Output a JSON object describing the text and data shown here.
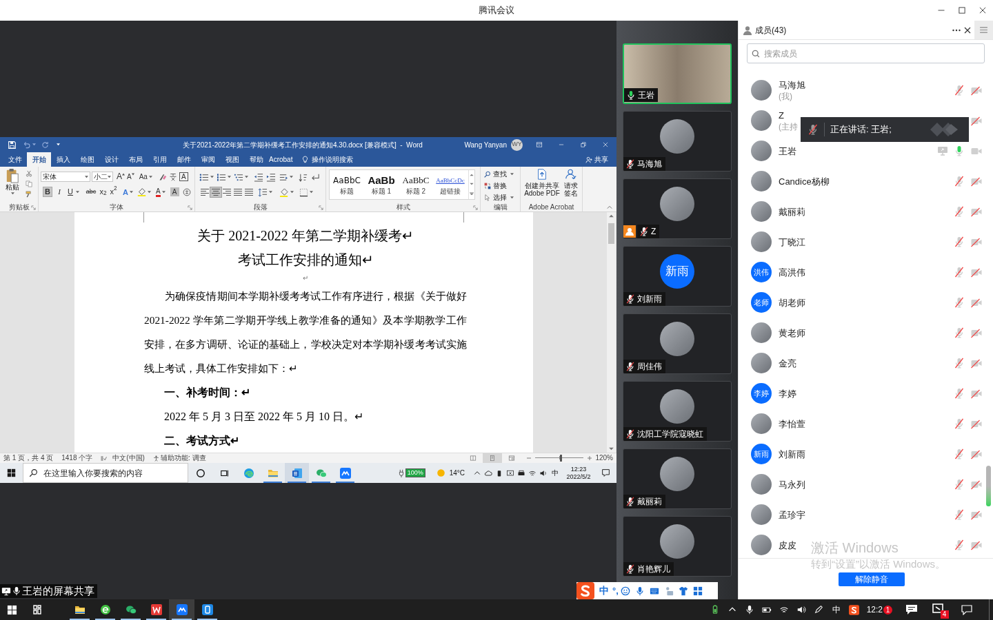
{
  "window": {
    "title": "腾讯会议"
  },
  "share": {
    "label": "王岩的屏幕共享",
    "word": {
      "title": "关于2021-2022年第二学期补缓考工作安排的通知4.30.docx [兼容模式]  -  Word",
      "user": "Wang Yanyan",
      "initials": "WY",
      "tabs": [
        {
          "label": "文件",
          "selected": false
        },
        {
          "label": "开始",
          "selected": true
        },
        {
          "label": "插入",
          "selected": false
        },
        {
          "label": "绘图",
          "selected": false
        },
        {
          "label": "设计",
          "selected": false
        },
        {
          "label": "布局",
          "selected": false
        },
        {
          "label": "引用",
          "selected": false
        },
        {
          "label": "邮件",
          "selected": false
        },
        {
          "label": "审阅",
          "selected": false
        },
        {
          "label": "视图",
          "selected": false
        },
        {
          "label": "帮助",
          "selected": false
        },
        {
          "label": "Acrobat",
          "selected": false
        }
      ],
      "tell_me": "操作说明搜索",
      "share_button": "共享",
      "clipboard": {
        "paste": "粘贴",
        "label": "剪贴板"
      },
      "font": {
        "name": "宋体",
        "size": "小二",
        "size_buttons": [
          "A",
          "A",
          "Aa"
        ],
        "border_button": "A",
        "format_buttons": [
          {
            "label": "B",
            "selected": true
          },
          {
            "label": "I",
            "selected": false
          },
          {
            "label": "U",
            "selected": false
          },
          {
            "label": "abc",
            "selected": false
          },
          {
            "label": "x$_{2}$",
            "selected": false
          },
          {
            "label": "x$^{2}$",
            "selected": false
          }
        ],
        "color_buttons": [
          "A",
          "A",
          "A"
        ],
        "label": "字体"
      },
      "paragraph": {
        "align_buttons": [
          {
            "selected": false
          },
          {
            "selected": true
          },
          {
            "selected": false
          },
          {
            "selected": false
          },
          {
            "selected": false
          }
        ],
        "label": "段落"
      },
      "styles": {
        "items": [
          {
            "kind": "title",
            "preview": "AaBbC",
            "name": "标题"
          },
          {
            "kind": "heading1",
            "preview": "AaBb",
            "name": "标题 1"
          },
          {
            "kind": "heading2",
            "preview": "AaBbC",
            "name": "标题 2"
          },
          {
            "kind": "hyperlink",
            "preview": "AaBbCcDc",
            "name": "超链接"
          }
        ],
        "label": "样式"
      },
      "editing": {
        "items": [
          {
            "kind": "find",
            "label": "查找"
          },
          {
            "kind": "replace",
            "label": "替换"
          },
          {
            "kind": "select",
            "label": "选择"
          }
        ],
        "label": "编辑"
      },
      "acrobat": {
        "items": [
          {
            "kind": "pdf",
            "label": "创建并共享 Adobe PDF"
          },
          {
            "kind": "sign",
            "label": "请求签名"
          }
        ],
        "label": "Adobe Acrobat"
      },
      "document": [
        {
          "kind": "title",
          "text": "关于 2021-2022 年第二学期补缓考↵"
        },
        {
          "kind": "title",
          "text": "考试工作安排的通知↵"
        },
        {
          "kind": "mark",
          "text": "↵"
        },
        {
          "kind": "body",
          "text": "为确保疫情期间本学期补缓考考试工作有序进行，根据《关于做好 2021-2022 学年第二学期开学线上教学准备的通知》及本学期教学工作安排，在多方调研、论证的基础上，学校决定对本学期补缓考考试实施线上考试，具体工作安排如下：↵"
        },
        {
          "kind": "heading",
          "text": "一、补考时间：↵"
        },
        {
          "kind": "item",
          "text": "2022 年 5 月 3 日至 2022 年 5 月 10 日。↵"
        },
        {
          "kind": "heading",
          "text": "二、考试方式↵"
        }
      ],
      "status_bar": {
        "page": "第 1 页，共 4 页",
        "words": "1418 个字",
        "language": "中文(中国)",
        "accessibility": "辅助功能: 调查",
        "views": [
          {
            "selected": false
          },
          {
            "selected": true
          },
          {
            "selected": false
          }
        ],
        "zoom_slider": {
          "level": 0.52
        },
        "zoom": "120%"
      }
    },
    "taskbar": {
      "search_placeholder": "在这里输入你要搜索的内容",
      "apps": [
        {
          "running": false,
          "active": false
        },
        {
          "running": true,
          "active": false
        },
        {
          "running": true,
          "active": true
        },
        {
          "running": true,
          "active": false
        },
        {
          "running": true,
          "active": false
        }
      ],
      "battery": "100%",
      "weather": "14°C",
      "ime": "中",
      "time": "12:23",
      "date": "2022/5/2"
    }
  },
  "video_tiles": [
    {
      "name": "王岩",
      "kind": "video",
      "muted": false,
      "speaking": true,
      "host": false
    },
    {
      "name": "马海旭",
      "kind": "photo",
      "muted": true,
      "speaking": false,
      "host": false
    },
    {
      "name": "Z",
      "kind": "photo",
      "muted": true,
      "speaking": false,
      "host": true
    },
    {
      "name": "刘新雨",
      "kind": "initials",
      "initials": "新雨",
      "muted": true,
      "speaking": false,
      "host": false
    },
    {
      "name": "周佳伟",
      "kind": "photo",
      "muted": true,
      "speaking": false,
      "host": false
    },
    {
      "name": "沈阳工学院寇晓虹",
      "kind": "photo",
      "muted": true,
      "speaking": false,
      "host": false
    },
    {
      "name": "戴丽莉",
      "kind": "photo",
      "muted": true,
      "speaking": false,
      "host": false
    },
    {
      "name": "肖艳辉儿",
      "kind": "photo",
      "muted": true,
      "speaking": false,
      "host": false
    }
  ],
  "members": {
    "title": "成员(43)",
    "search_placeholder": "搜索成员",
    "items": [
      {
        "name": "马海旭",
        "note": "(我)",
        "kind": "photo",
        "muted": true,
        "camera_on": false,
        "sharing": false
      },
      {
        "name": "Z",
        "note": "(主持",
        "kind": "photo",
        "camera_on": false,
        "sharing": false
      },
      {
        "name": "王岩",
        "kind": "photo",
        "muted": false,
        "camera_on": true,
        "sharing": true
      },
      {
        "name": "Candice杨柳",
        "kind": "photo",
        "muted": true,
        "camera_on": false,
        "sharing": false
      },
      {
        "name": "戴丽莉",
        "kind": "photo",
        "muted": true,
        "camera_on": false,
        "sharing": false
      },
      {
        "name": "丁晓江",
        "kind": "photo",
        "muted": true,
        "camera_on": false,
        "sharing": false
      },
      {
        "name": "高洪伟",
        "kind": "initials",
        "initials": "洪伟",
        "muted": true,
        "camera_on": false,
        "sharing": false
      },
      {
        "name": "胡老师",
        "kind": "initials",
        "initials": "老师",
        "muted": true,
        "camera_on": false,
        "sharing": false
      },
      {
        "name": "黄老师",
        "kind": "photo",
        "muted": true,
        "camera_on": false,
        "sharing": false
      },
      {
        "name": "金亮",
        "kind": "photo",
        "muted": true,
        "camera_on": false,
        "sharing": false
      },
      {
        "name": "李婷",
        "kind": "initials",
        "initials": "李婷",
        "muted": true,
        "camera_on": false,
        "sharing": false
      },
      {
        "name": "李怡萱",
        "kind": "photo",
        "muted": true,
        "camera_on": false,
        "sharing": false
      },
      {
        "name": "刘新雨",
        "kind": "initials",
        "initials": "新雨",
        "muted": true,
        "camera_on": false,
        "sharing": false
      },
      {
        "name": "马永列",
        "kind": "photo",
        "muted": true,
        "camera_on": false,
        "sharing": false
      },
      {
        "name": "孟珍宇",
        "kind": "photo",
        "muted": true,
        "camera_on": false,
        "sharing": false
      },
      {
        "name": "皮皮",
        "kind": "photo",
        "muted": true,
        "camera_on": false,
        "sharing": false
      }
    ],
    "unmute_button": "解除静音"
  },
  "speaking_notice": "正在讲话: 王岩;",
  "activation_notice": {
    "title": "激活 Windows",
    "subtitle": "转到“设置”以激活 Windows。"
  },
  "ime_toolbar": {
    "mode": "中",
    "punctuation": "°,"
  },
  "taskbar": {
    "apps": [
      {
        "running": false,
        "active": false
      },
      {
        "running": true,
        "active": false
      },
      {
        "running": true,
        "active": false
      },
      {
        "running": true,
        "active": false
      },
      {
        "running": true,
        "active": false
      },
      {
        "running": true,
        "active": true
      },
      {
        "running": true,
        "active": false
      }
    ],
    "ime": "中",
    "time": "12:2",
    "time_badge": "1",
    "app_badge": "4"
  }
}
